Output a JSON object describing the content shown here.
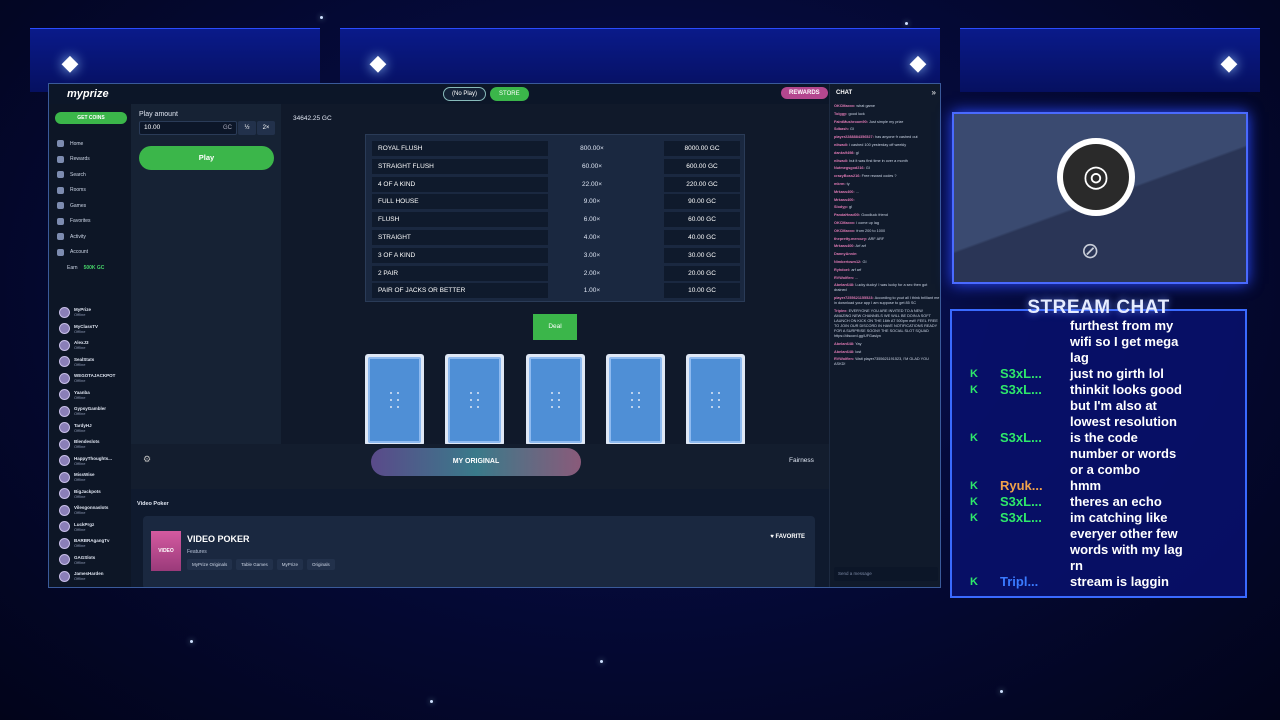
{
  "browser": {
    "logo": "myprize",
    "nav": {
      "noplay": "(No Play)",
      "store": "STORE",
      "rewards": "REWARDS"
    }
  },
  "sidebar": {
    "get_coins": "GET COINS",
    "items": [
      "Home",
      "Rewards",
      "Search",
      "Rooms",
      "Games",
      "Favorites",
      "Activity",
      "Account"
    ],
    "earn_prefix": "Earn",
    "earn_amount": "500K GC",
    "friends": [
      {
        "name": "MyPrize",
        "status": "Offline"
      },
      {
        "name": "MyClassTV",
        "status": "Offline"
      },
      {
        "name": "AlexJ3",
        "status": "Offline"
      },
      {
        "name": "SealStats",
        "status": "Offline"
      },
      {
        "name": "WEGOTAJACKPOT",
        "status": "Offline"
      },
      {
        "name": "Yaanba",
        "status": "Offline"
      },
      {
        "name": "GypsyGambler",
        "status": "Offline"
      },
      {
        "name": "TardyHJ",
        "status": "Offline"
      },
      {
        "name": "Blendeslots",
        "status": "Offline"
      },
      {
        "name": "HappyThoughts...",
        "status": "Offline"
      },
      {
        "name": "MissWise",
        "status": "Offline"
      },
      {
        "name": "BigJackpots",
        "status": "Offline"
      },
      {
        "name": "Vilesgonnaslots",
        "status": "Offline"
      },
      {
        "name": "LuckPrgz",
        "status": "Offline"
      },
      {
        "name": "BARBRAgangTv",
        "status": "Offline"
      },
      {
        "name": "GAGSlots",
        "status": "Offline"
      },
      {
        "name": "JamesHarden",
        "status": "Offline"
      }
    ]
  },
  "controls": {
    "play_amount_label": "Play amount",
    "amount_value": "10.00",
    "currency": "GC",
    "half": "½",
    "double": "2×",
    "play_button": "Play"
  },
  "game": {
    "balance": "34642.25 GC",
    "paytable": [
      {
        "hand": "ROYAL FLUSH",
        "mult": "800.00×",
        "pay": "8000.00 GC"
      },
      {
        "hand": "STRAIGHT FLUSH",
        "mult": "60.00×",
        "pay": "600.00 GC"
      },
      {
        "hand": "4 OF A KIND",
        "mult": "22.00×",
        "pay": "220.00 GC"
      },
      {
        "hand": "FULL HOUSE",
        "mult": "9.00×",
        "pay": "90.00 GC"
      },
      {
        "hand": "FLUSH",
        "mult": "6.00×",
        "pay": "60.00 GC"
      },
      {
        "hand": "STRAIGHT",
        "mult": "4.00×",
        "pay": "40.00 GC"
      },
      {
        "hand": "3 OF A KIND",
        "mult": "3.00×",
        "pay": "30.00 GC"
      },
      {
        "hand": "2 PAIR",
        "mult": "2.00×",
        "pay": "20.00 GC"
      },
      {
        "hand": "PAIR OF JACKS OR BETTER",
        "mult": "1.00×",
        "pay": "10.00 GC"
      }
    ],
    "deal": "Deal",
    "my_original": "MY ORIGINAL",
    "fairness": "Fairness"
  },
  "info": {
    "section_label": "Video Poker",
    "thumb": "VIDEO POKER",
    "title": "VIDEO POKER",
    "features": "Features",
    "tags": [
      "MyPrize Originals",
      "Table Games",
      "MyPrize",
      "Originals"
    ],
    "favorite": "FAVORITE"
  },
  "site_chat": {
    "header": "CHAT",
    "input_placeholder": "Send a message",
    "messages": [
      {
        "user": "OKCMaxxx:",
        "text": "what game"
      },
      {
        "user": "Tolggy:",
        "text": "good luck"
      },
      {
        "user": "FaintMushroom90:",
        "text": "Just simple my prize"
      },
      {
        "user": "Sdbash:",
        "text": "GI"
      },
      {
        "user": "player2288884356527:",
        "text": "has anyone fr cashed out"
      },
      {
        "user": "nilwadi:",
        "text": "i cashed 100 yesterday off weekly"
      },
      {
        "user": "danks9498:",
        "text": "gl"
      },
      {
        "user": "nilwadi:",
        "text": "but it was first time in over a month"
      },
      {
        "user": "Nutmegsgod216:",
        "text": "GI"
      },
      {
        "user": "crazyBoss216:",
        "text": "Free reward codes ?"
      },
      {
        "user": "mkrm:",
        "text": "ty"
      },
      {
        "user": "Mrkass400:",
        "text": "..."
      },
      {
        "user": "Mrkass400:",
        "text": ""
      },
      {
        "user": "Slodyp:",
        "text": "gl"
      },
      {
        "user": "PandaHead00:",
        "text": "Goodluck friend"
      },
      {
        "user": "OKCMaxxx:",
        "text": "i come up lag"
      },
      {
        "user": "OKCMaxxx:",
        "text": "from 200 to 1000"
      },
      {
        "user": "thepretty.mercury:",
        "text": "ARF ARF"
      },
      {
        "user": "Mrkass400:",
        "text": "Arf arf"
      },
      {
        "user": "DannyAnnie:",
        "text": ""
      },
      {
        "user": "Nimbertown12:",
        "text": "GI"
      },
      {
        "user": "Ryhdoel:",
        "text": "arf arf"
      },
      {
        "user": "RVWolflen:",
        "text": "..."
      },
      {
        "user": "Abelan648:",
        "text": "Lucky ducky! I was lucky for a sec then got drained"
      },
      {
        "user": "player7255621155523:",
        "text": "According to yout all I think brilliant me in download your app I am suppose to get 85 SC"
      },
      {
        "user": "Triplex:",
        "text": "EVERYONE YOU ARE INVITED TO A NEW AMAZING NEW CHANNELS WE WILL BE DOIN A SOFT LAUNCH ON KICK ON THE 16th AT 500pm est!! FEEL FREE TO JOIN OUR DISCORD IN HAVE NOTIFICATIONS READY FOR A SURPRISE SOON!! THE SOCIAL SLOT SQUAD https://discord.gg/UFGaslyn"
      },
      {
        "user": "Abelan648:",
        "text": "Yay"
      },
      {
        "user": "Abelan648:",
        "text": "lost"
      },
      {
        "user": "RVWolflen:",
        "text": "Wait player7355621191523, I'M GLAD YOU ASKD!"
      }
    ]
  },
  "stream_chat": {
    "title": "STREAM CHAT",
    "lines": [
      {
        "user": "",
        "text": "furthest from my"
      },
      {
        "user": "",
        "text": "wifi so I get mega"
      },
      {
        "user": "",
        "text": "lag"
      },
      {
        "user": "S3xL...",
        "text": "just no girth lol",
        "k": true,
        "color": "#2ee86a"
      },
      {
        "user": "S3xL...",
        "text": "thinkit looks good",
        "k": true,
        "color": "#2ee86a"
      },
      {
        "user": "",
        "text": "but I'm also at"
      },
      {
        "user": "",
        "text": "lowest resolution"
      },
      {
        "user": "S3xL...",
        "text": "is the code",
        "k": true,
        "color": "#2ee86a"
      },
      {
        "user": "",
        "text": "number or words"
      },
      {
        "user": "",
        "text": "or a combo"
      },
      {
        "user": "Ryuk...",
        "text": "hmm",
        "k": true,
        "color": "#f0a24a"
      },
      {
        "user": "S3xL...",
        "text": "theres an echo",
        "k": true,
        "color": "#2ee86a"
      },
      {
        "user": "S3xL...",
        "text": "im catching like",
        "k": true,
        "color": "#2ee86a"
      },
      {
        "user": "",
        "text": "everyer other few"
      },
      {
        "user": "",
        "text": "words with my lag"
      },
      {
        "user": "",
        "text": "rn"
      },
      {
        "user": "Tripl...",
        "text": "stream is laggin",
        "k": true,
        "color": "#3a7aff"
      }
    ]
  }
}
